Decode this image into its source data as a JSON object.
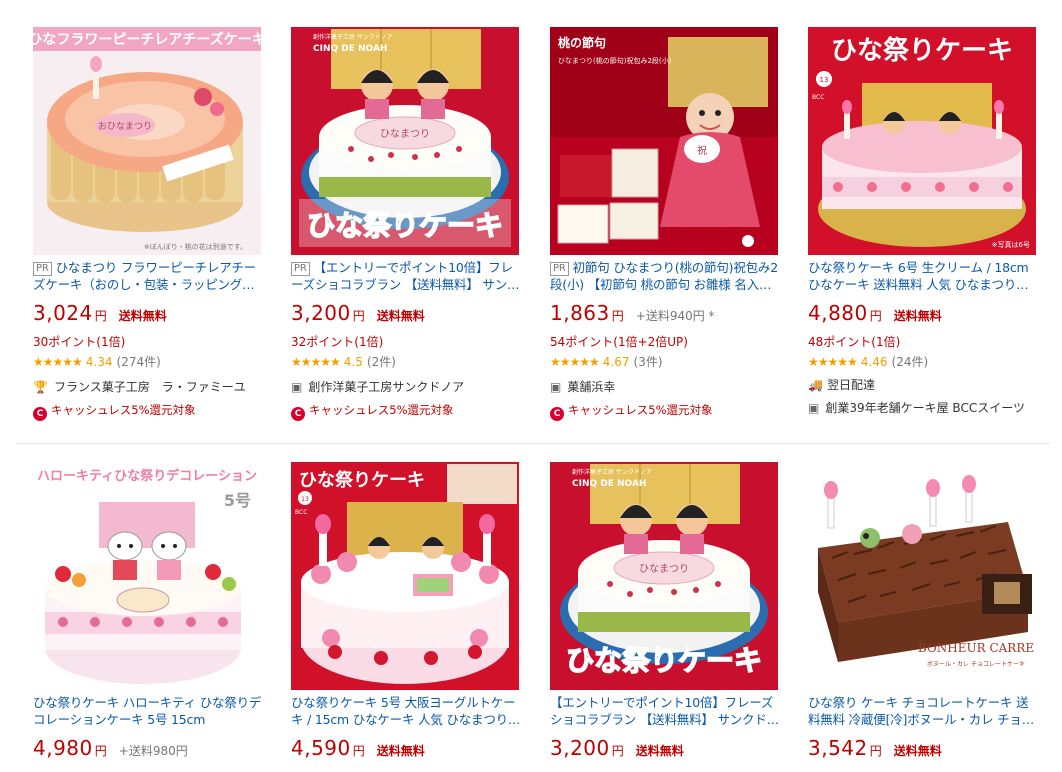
{
  "row1": [
    {
      "pr": "PR",
      "title": "ひなまつり フラワーピーチレアチーズケーキ（おのし・包装・ラッピング…",
      "price": "3,024",
      "yen": "円",
      "shipping": "送料無料",
      "points": "30ポイント(1倍)",
      "score": "4.34",
      "count": "(274件)",
      "stars": "★★★★★",
      "shop": "フランス菓子工房　ラ・ファミーユ",
      "shop_icon": "trophy-icon",
      "cashless": "キャッシュレス5%還元対象",
      "image": {
        "banner": "ひなフラワーピーチレアチーズケーキ",
        "caption": "※ぼんぼり・桃の花は別途です。"
      }
    },
    {
      "pr": "PR",
      "title": "【エントリーでポイント10倍】フレーズショコラブラン 【送料無料】 サン…",
      "price": "3,200",
      "yen": "円",
      "shipping": "送料無料",
      "points": "32ポイント(1倍)",
      "score": "4.5",
      "count": "(2件)",
      "stars": "★★★★★",
      "shop": "創作洋菓子工房サンクドノア",
      "shop_icon": "store-icon",
      "cashless": "キャッシュレス5%還元対象",
      "image": {
        "brand": "CINQ DE NOAH",
        "banner": "ひな祭りケーキ",
        "plaque": "ひなまつり"
      }
    },
    {
      "pr": "PR",
      "title": "初節句 ひなまつり(桃の節句)祝包み2段(小) 【初節句 桃の節句 お雛様 名入…",
      "price": "1,863",
      "yen": "円",
      "shipping_fee": "+送料940円 *",
      "points": "54ポイント(1倍+2倍UP)",
      "score": "4.67",
      "count": "(3件)",
      "stars": "★★★★★",
      "shop": "菓舗浜幸",
      "shop_icon": "store-icon",
      "cashless": "キャッシュレス5%還元対象",
      "image": {
        "banner": "桃の節句",
        "sub": "ひなまつり(桃の節句)祝包み2段(小)"
      }
    },
    {
      "title": "ひな祭りケーキ 6号 生クリーム / 18cm ひなケーキ 送料無料 人気 ひなまつり…",
      "price": "4,880",
      "yen": "円",
      "shipping": "送料無料",
      "points": "48ポイント(1倍)",
      "score": "4.46",
      "count": "(24件)",
      "stars": "★★★★★",
      "delivery": "翌日配達",
      "shop": "創業39年老舗ケーキ屋 BCCスイーツ",
      "shop_icon": "store-icon",
      "image": {
        "banner": "ひな祭りケーキ",
        "badge": "BCC",
        "caption": "※写真は6号"
      }
    }
  ],
  "row2": [
    {
      "title": "ひな祭りケーキ ハローキティ ひな祭りデコレーションケーキ 5号 15cm",
      "price": "4,980",
      "yen": "円",
      "shipping_fee": "+送料980円",
      "image": {
        "banner": "ハローキティひな祭りデコレーション",
        "size": "5号"
      }
    },
    {
      "title": "ひな祭りケーキ 5号 大阪ヨーグルトケーキ / 15cm ひなケーキ 人気 ひなまつり…",
      "price": "4,590",
      "yen": "円",
      "shipping": "送料無料",
      "image": {
        "banner": "ひな祭りケーキ",
        "badge": "BCC"
      }
    },
    {
      "title": "【エントリーでポイント10倍】フレーズショコラブラン 【送料無料】 サンクド…",
      "price": "3,200",
      "yen": "円",
      "shipping": "送料無料",
      "image": {
        "brand": "CINQ DE NOAH",
        "banner": "ひな祭りケーキ",
        "plaque": "ひなまつり"
      }
    },
    {
      "title": "ひな祭り ケーキ チョコレートケーキ 送料無料 冷蔵便[冷]ボヌール・カレ チョ…",
      "price": "3,542",
      "yen": "円",
      "shipping": "送料無料",
      "image": {
        "brand": "BONHEUR CARRE"
      }
    }
  ],
  "colors": {
    "link": "#0a59a8",
    "price": "#bf0000",
    "star": "#f0a000",
    "muted": "#777777"
  }
}
